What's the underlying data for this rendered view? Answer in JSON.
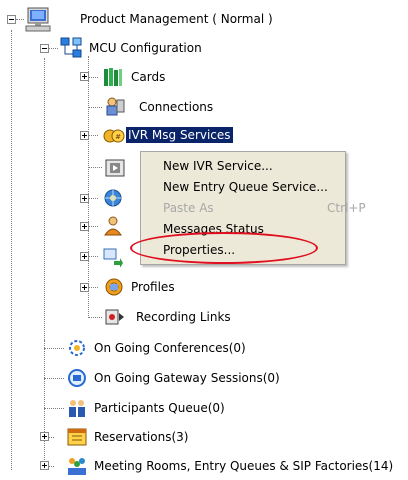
{
  "tree": {
    "root": {
      "label": "Product Management  ( Normal )",
      "icon": "monitor-icon"
    },
    "mcu": {
      "label": "MCU Configuration",
      "icon": "network-icon"
    },
    "mcu_children": [
      {
        "label": "Cards",
        "icon": "books-icon",
        "expander": "plus"
      },
      {
        "label": "Connections",
        "icon": "connections-icon",
        "expander": ""
      },
      {
        "label": "IVR Msg Services",
        "icon": "coins-icon",
        "expander": "plus",
        "selected": true
      },
      {
        "label": "",
        "icon": "film-icon",
        "expander": ""
      },
      {
        "label": "",
        "icon": "gear-globe-icon",
        "expander": "plus"
      },
      {
        "label": "",
        "icon": "person-icon",
        "expander": "plus"
      },
      {
        "label": "",
        "icon": "arrow-folder-icon",
        "expander": "plus"
      },
      {
        "label": "Profiles",
        "icon": "profile-gear-icon",
        "expander": "plus"
      },
      {
        "label": "Recording Links",
        "icon": "recording-icon",
        "expander": ""
      }
    ],
    "root_children": [
      {
        "label": "On Going Conferences(0)",
        "icon": "conference-icon",
        "expander": ""
      },
      {
        "label": "On Going Gateway Sessions(0)",
        "icon": "gateway-icon",
        "expander": ""
      },
      {
        "label": "Participants Queue(0)",
        "icon": "people-icon",
        "expander": ""
      },
      {
        "label": "Reservations(3)",
        "icon": "calendar-icon",
        "expander": "plus"
      },
      {
        "label": "Meeting Rooms, Entry Queues & SIP Factories(14)",
        "icon": "group-icon",
        "expander": "plus"
      }
    ]
  },
  "context_menu": {
    "items": [
      {
        "label": "New IVR Service...",
        "enabled": true,
        "shortcut": ""
      },
      {
        "label": "New Entry Queue Service...",
        "enabled": true,
        "shortcut": ""
      },
      {
        "label": "Paste As",
        "enabled": false,
        "shortcut": "Ctrl+P"
      },
      {
        "label": "Messages Status",
        "enabled": true,
        "shortcut": ""
      },
      {
        "label": "Properties...",
        "enabled": true,
        "shortcut": ""
      }
    ]
  },
  "colors": {
    "selection": "#0a246a",
    "menu_bg": "#ece9d8",
    "highlight_oval": "#e01020"
  }
}
